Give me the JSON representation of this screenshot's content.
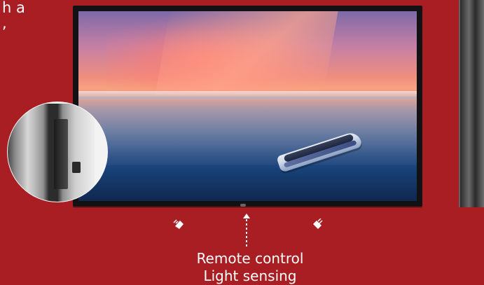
{
  "heading": {
    "fragment_line1": "h a",
    "fragment_line2": ","
  },
  "labels": {
    "remote_control": "Remote control",
    "light_sensing": "Light sensing"
  },
  "icons": {
    "left_sensor": "sensor-icon",
    "right_sensor": "sensor-icon",
    "center_arrow": "up-arrow-icon"
  }
}
